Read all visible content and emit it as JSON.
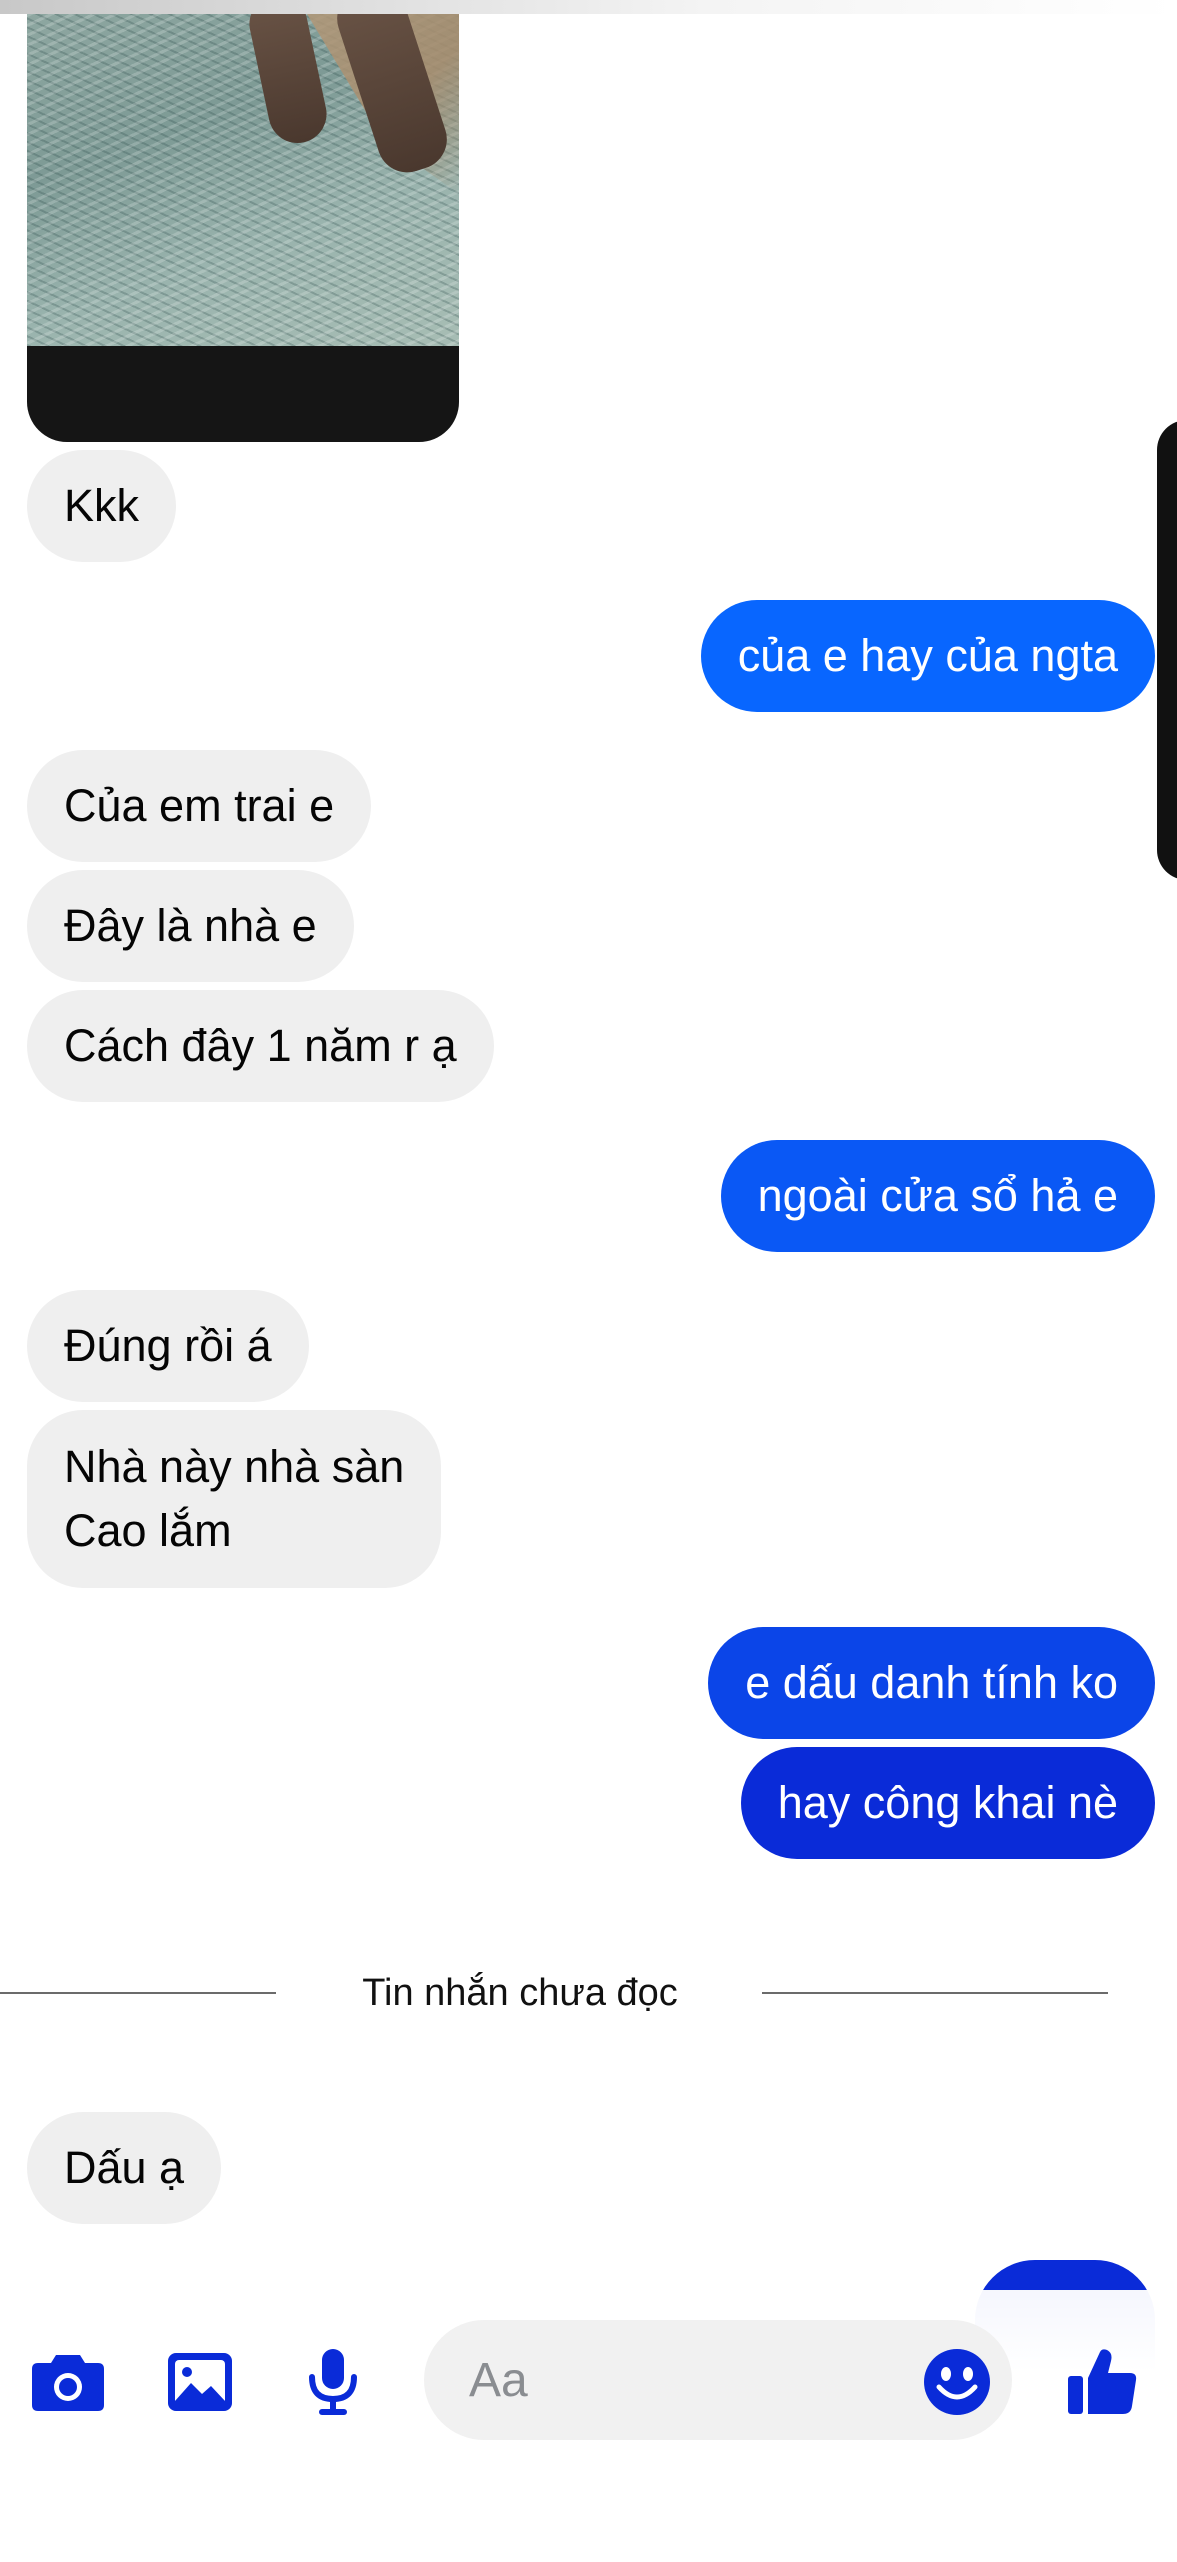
{
  "conversation": {
    "messages": [
      {
        "id": "m1",
        "direction": "incoming",
        "lines": [
          "Kkk"
        ]
      },
      {
        "id": "m2",
        "direction": "outgoing",
        "lines": [
          "của e hay của ngta"
        ]
      },
      {
        "id": "m3",
        "direction": "incoming",
        "lines": [
          "Của em trai e"
        ]
      },
      {
        "id": "m4",
        "direction": "incoming",
        "lines": [
          "Đây là nhà e"
        ]
      },
      {
        "id": "m5",
        "direction": "incoming",
        "lines": [
          "Cách đây 1 năm r ạ"
        ]
      },
      {
        "id": "m6",
        "direction": "outgoing",
        "lines": [
          "ngoài cửa sổ hả e"
        ]
      },
      {
        "id": "m7",
        "direction": "incoming",
        "lines": [
          "Đúng rồi á"
        ]
      },
      {
        "id": "m8",
        "direction": "incoming",
        "lines": [
          "Nhà này nhà sàn",
          "Cao lắm"
        ]
      },
      {
        "id": "m9",
        "direction": "outgoing",
        "lines": [
          "e dấu danh tính ko"
        ]
      },
      {
        "id": "m10",
        "direction": "outgoing",
        "lines": [
          "hay công khai nè"
        ]
      },
      {
        "id": "m11",
        "direction": "incoming",
        "lines": [
          "Dấu ạ"
        ]
      }
    ],
    "unread_divider": "Tin nhắn chưa đọc"
  },
  "composer": {
    "placeholder": "Aa",
    "icons": [
      "camera-icon",
      "image-icon",
      "microphone-icon",
      "emoji-icon",
      "thumbs-up-icon"
    ]
  },
  "colors": {
    "incoming_bubble": "#efefef",
    "outgoing_bubble_top": "#0866ff",
    "outgoing_bubble_bottom": "#0a2bd8",
    "accent_icon": "#0a2bd8"
  }
}
